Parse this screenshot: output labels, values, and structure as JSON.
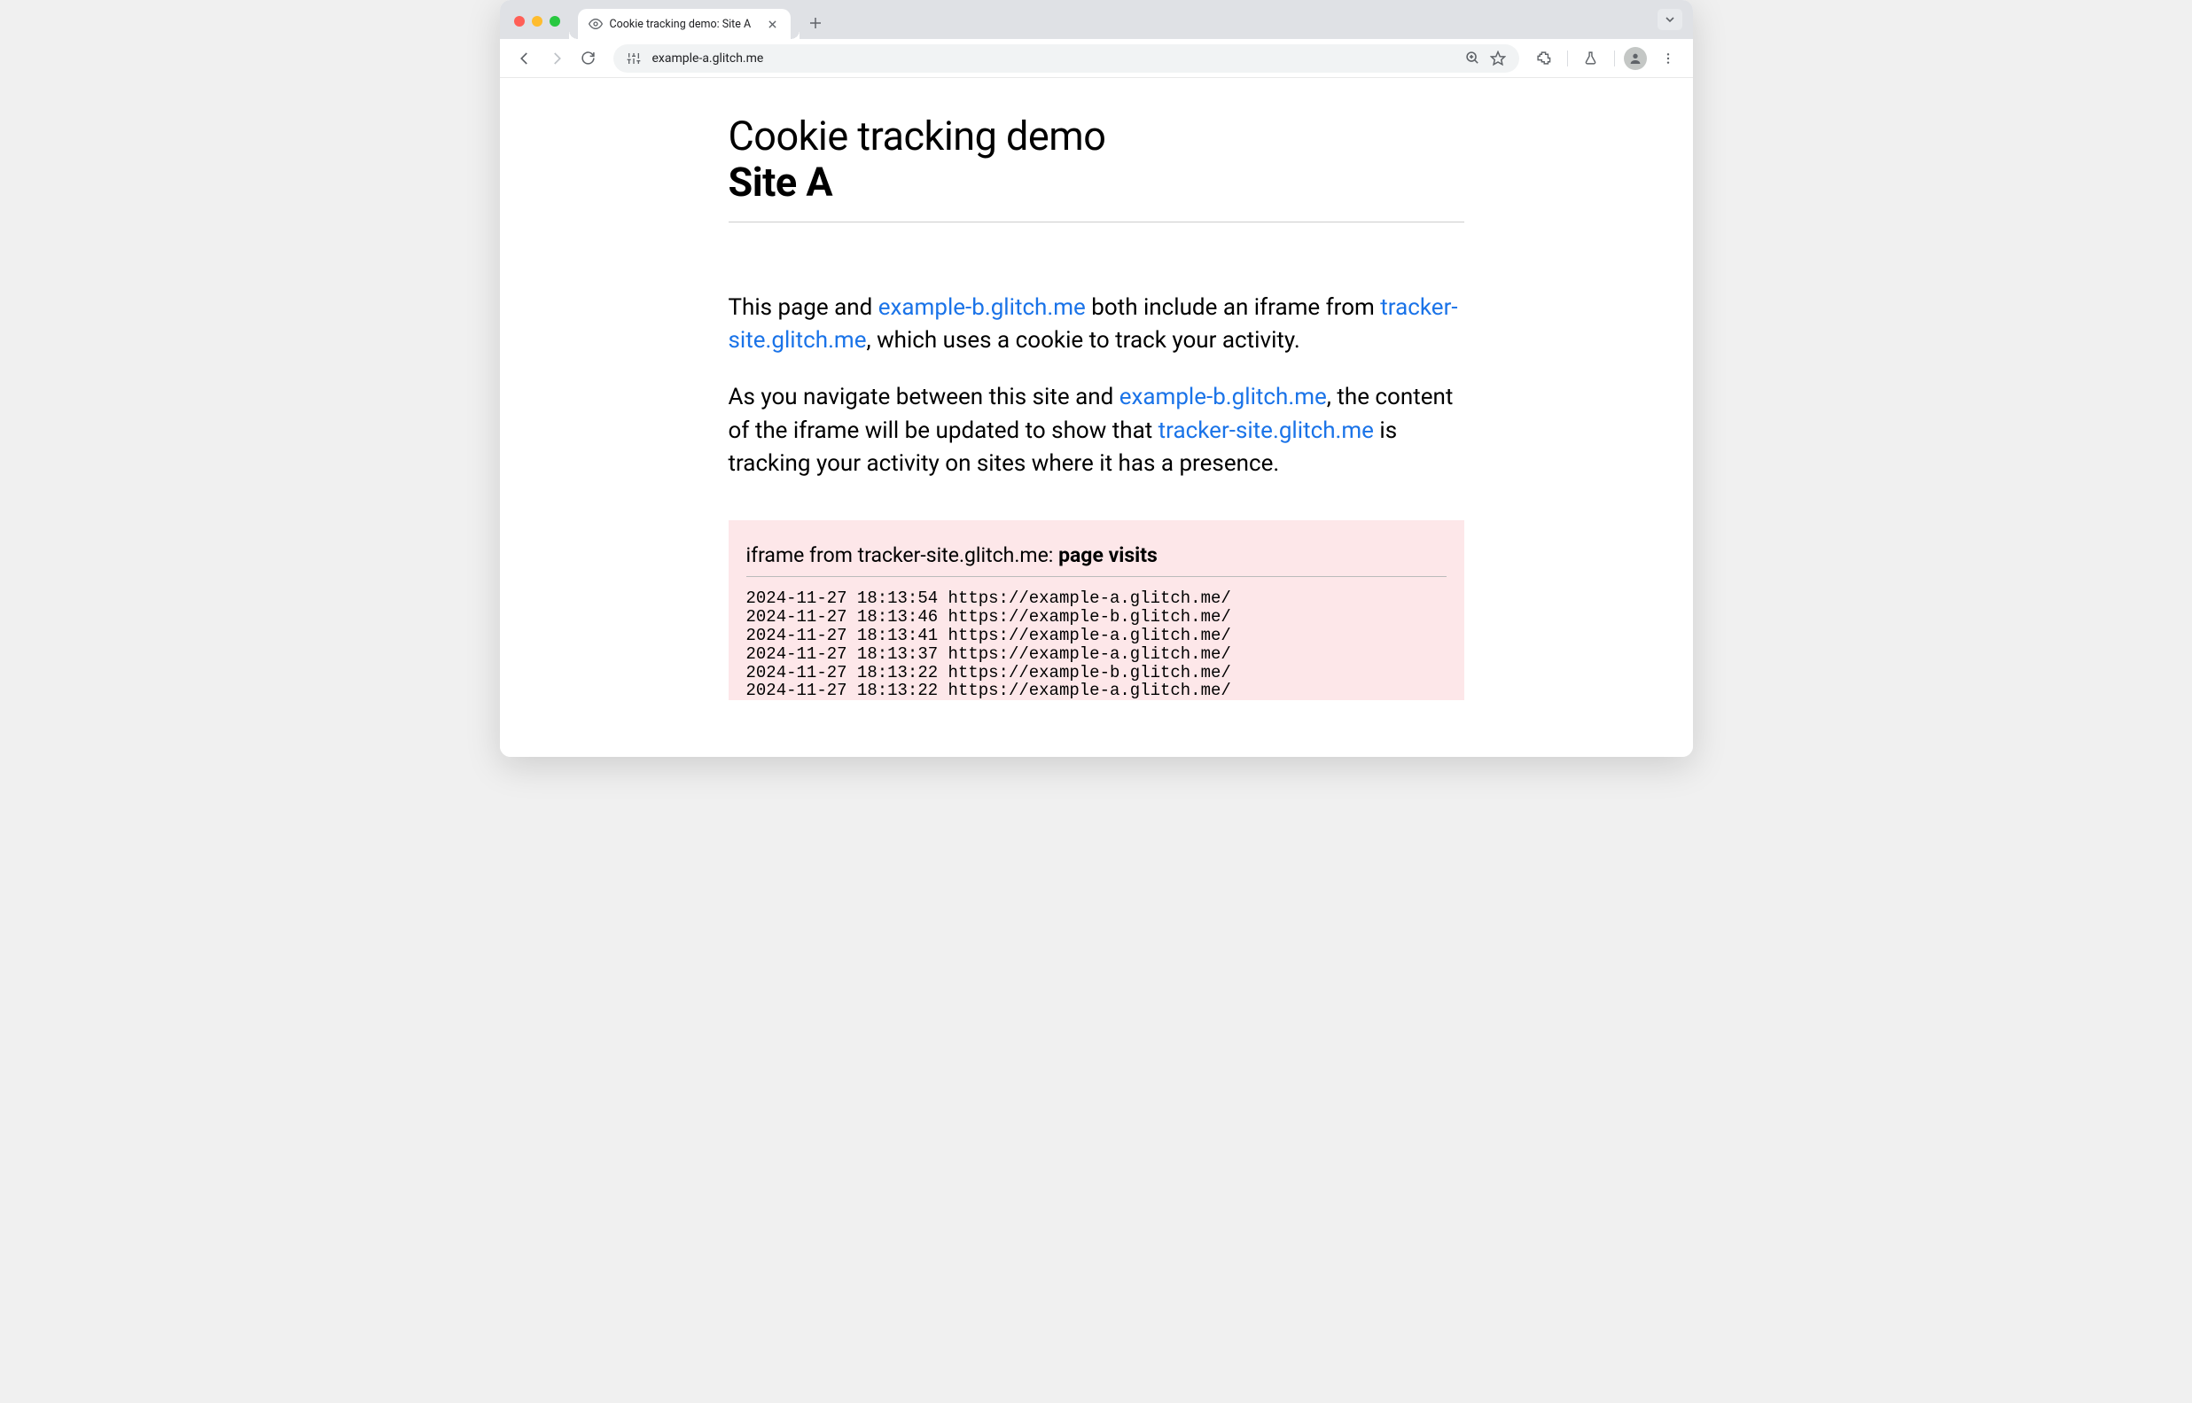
{
  "browser": {
    "tab_title": "Cookie tracking demo: Site A",
    "url": "example-a.glitch.me"
  },
  "page": {
    "heading_line1": "Cookie tracking demo",
    "heading_line2": "Site A",
    "p1_a": "This page and ",
    "p1_link1": "example-b.glitch.me",
    "p1_b": " both include an iframe from ",
    "p1_link2": "tracker-site.glitch.me",
    "p1_c": ", which uses a cookie to track your activity.",
    "p2_a": "As you navigate between this site and ",
    "p2_link1": "example-b.glitch.me",
    "p2_b": ", the content of the iframe will be updated to show that ",
    "p2_link2": "tracker-site.glitch.me",
    "p2_c": " is tracking your activity on sites where it has a presence."
  },
  "iframe": {
    "heading_prefix": "iframe from tracker-site.glitch.me: ",
    "heading_bold": "page visits",
    "visits": [
      "2024-11-27 18:13:54 https://example-a.glitch.me/",
      "2024-11-27 18:13:46 https://example-b.glitch.me/",
      "2024-11-27 18:13:41 https://example-a.glitch.me/",
      "2024-11-27 18:13:37 https://example-a.glitch.me/",
      "2024-11-27 18:13:22 https://example-b.glitch.me/",
      "2024-11-27 18:13:22 https://example-a.glitch.me/"
    ]
  }
}
